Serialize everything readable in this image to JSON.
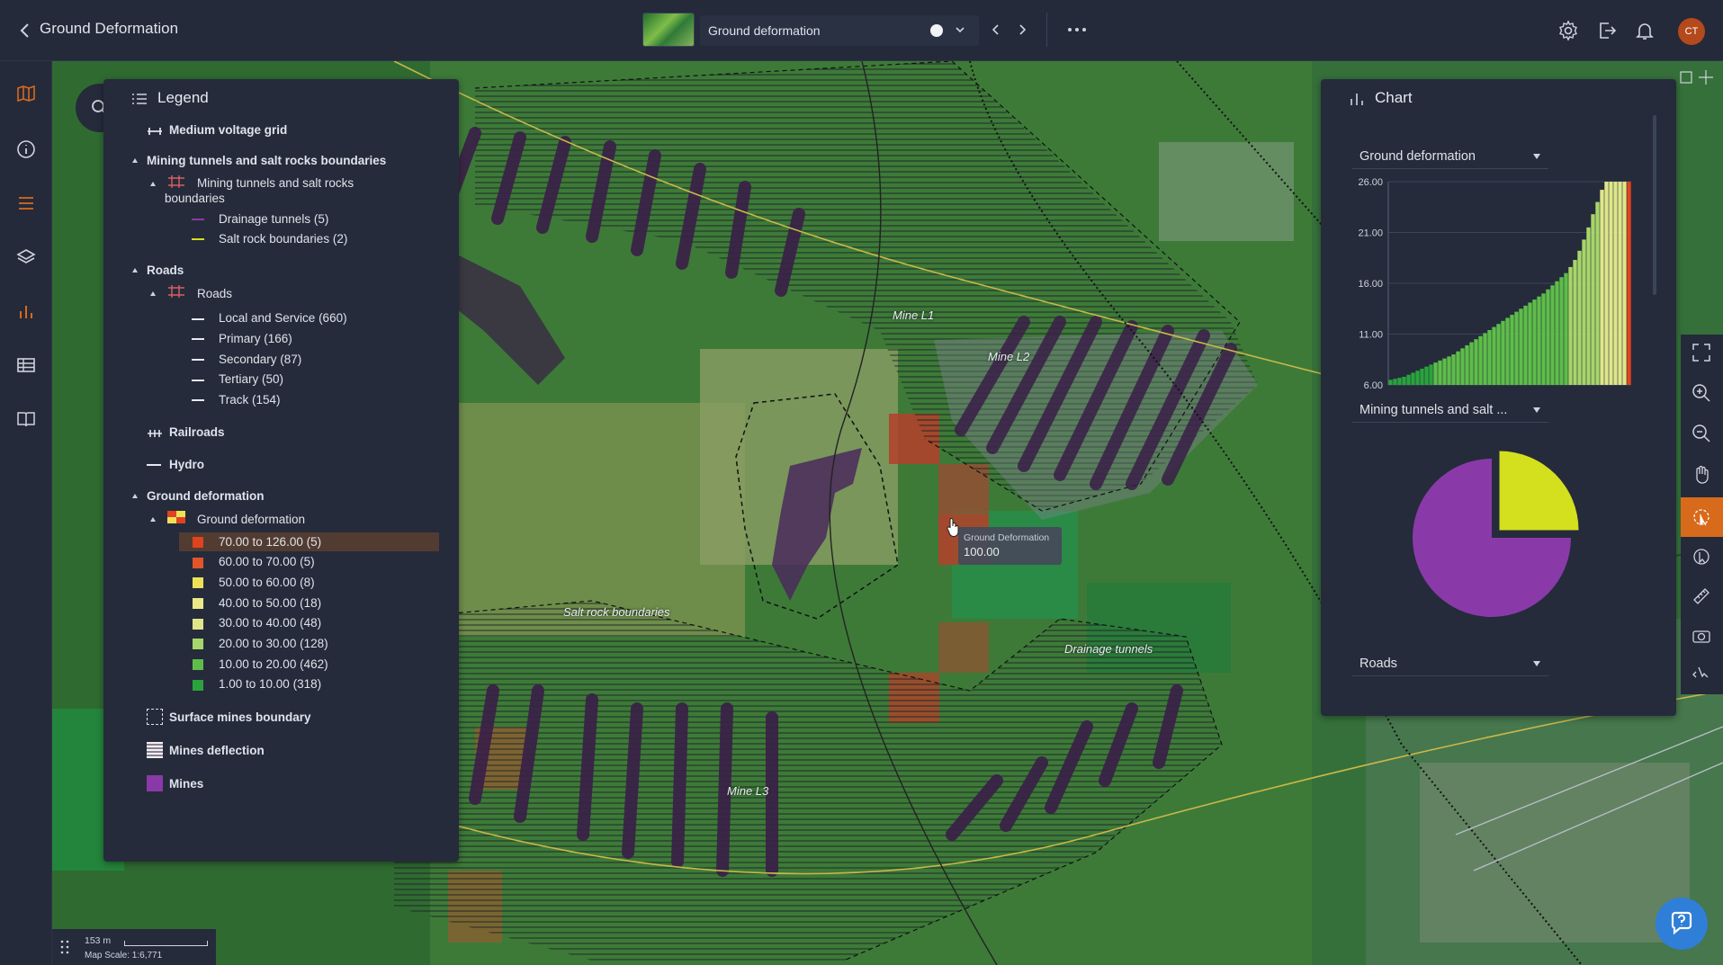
{
  "header": {
    "title": "Ground Deformation",
    "layer_selector": "Ground deformation",
    "avatar": "CT"
  },
  "legend": {
    "title": "Legend",
    "medium_voltage": "Medium voltage grid",
    "mining_group": "Mining tunnels and salt rocks boundaries",
    "mining_sub": "Mining tunnels and salt rocks",
    "mining_sub2": "boundaries",
    "drainage": "Drainage tunnels (5)",
    "salt": "Salt rock boundaries (2)",
    "roads_group": "Roads",
    "roads_sub": "Roads",
    "roads_items": [
      "Local and Service (660)",
      "Primary (166)",
      "Secondary (87)",
      "Tertiary (50)",
      "Track (154)"
    ],
    "railroads": "Railroads",
    "hydro": "Hydro",
    "gd_group": "Ground deformation",
    "gd_sub": "Ground deformation",
    "gd_classes": [
      {
        "label": "70.00 to 126.00 (5)",
        "color": "#e0431f"
      },
      {
        "label": "60.00 to 70.00 (5)",
        "color": "#e0562a"
      },
      {
        "label": "50.00 to 60.00 (8)",
        "color": "#efe05a"
      },
      {
        "label": "40.00 to 50.00 (18)",
        "color": "#eae98a"
      },
      {
        "label": "30.00 to 40.00 (48)",
        "color": "#dfe68a"
      },
      {
        "label": "20.00 to 30.00 (128)",
        "color": "#a7d66a"
      },
      {
        "label": "10.00 to 20.00 (462)",
        "color": "#5ebd4a"
      },
      {
        "label": "1.00 to 10.00 (318)",
        "color": "#2aa33e"
      }
    ],
    "surface_mines": "Surface mines boundary",
    "mines_deflection": "Mines deflection",
    "mines": "Mines"
  },
  "chart_panel": {
    "title": "Chart",
    "dropdown1": "Ground deformation",
    "dropdown2": "Mining tunnels and salt ...",
    "dropdown3": "Roads"
  },
  "chart_data": [
    {
      "type": "bar",
      "title": "",
      "ylim": [
        6,
        26
      ],
      "y_ticks": [
        "26.00",
        "21.00",
        "16.00",
        "11.00",
        "6.00"
      ],
      "values": [
        6.5,
        6.6,
        6.7,
        6.8,
        7.0,
        7.2,
        7.4,
        7.6,
        7.8,
        8.0,
        8.2,
        8.4,
        8.6,
        8.8,
        9.0,
        9.3,
        9.6,
        9.9,
        10.2,
        10.5,
        10.8,
        11.1,
        11.4,
        11.7,
        12.0,
        12.3,
        12.6,
        12.9,
        13.2,
        13.5,
        13.8,
        14.1,
        14.4,
        14.7,
        15.0,
        15.4,
        15.8,
        16.2,
        16.6,
        17.0,
        17.6,
        18.3,
        19.2,
        20.3,
        21.5,
        22.8,
        24.0,
        25.2,
        26.0,
        26.0,
        26.0,
        26.0,
        26.0,
        26.0
      ],
      "colors": {
        "low": "#2aa33e",
        "mid": "#5ebd4a",
        "high": "#a7d66a",
        "top": "#dfe68a",
        "max": "#e0431f"
      }
    },
    {
      "type": "pie",
      "values": [
        25,
        75
      ],
      "colors": [
        "#d4df1d",
        "#8a3aa8"
      ]
    }
  ],
  "map": {
    "labels": {
      "mine_l1": "Mine L1",
      "mine_l2": "Mine L2",
      "mine_l3": "Mine L3",
      "salt_rock": "Salt rock boundaries",
      "drainage": "Drainage tunnels"
    },
    "tooltip_title": "Ground Deformation",
    "tooltip_value": "100.00",
    "scale_distance": "153 m",
    "scale_text": "Map Scale: 1:6,771"
  }
}
